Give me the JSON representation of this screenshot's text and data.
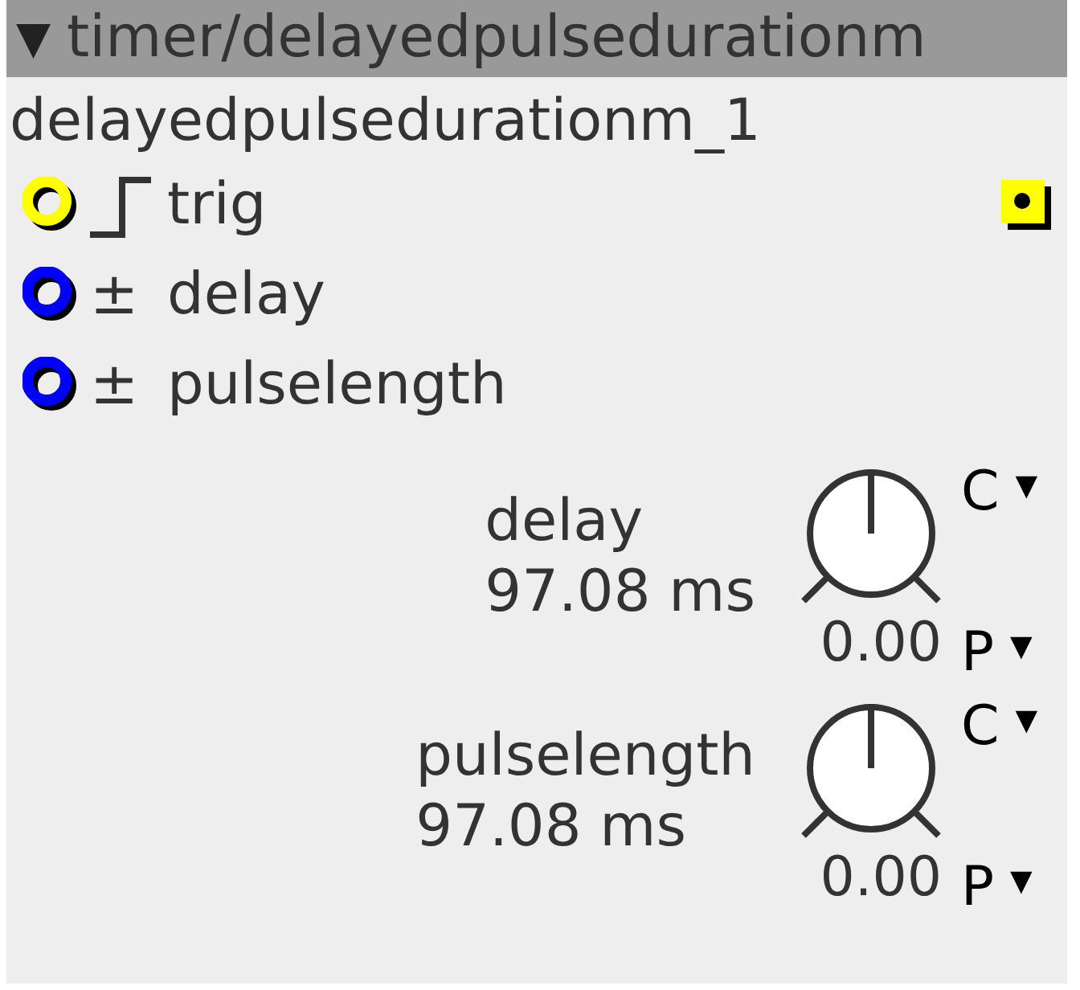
{
  "object": {
    "collapse": "▼",
    "type_name": "timer/delayedpulsedurationm",
    "instance_name": "delayedpulsedurationm_1"
  },
  "inlets": [
    {
      "kind": "bool",
      "label": "trig",
      "color": "#ffff00",
      "outlet": true
    },
    {
      "kind": "frac",
      "symbol": "±",
      "label": "delay",
      "color": "#0000ff",
      "outlet": false
    },
    {
      "kind": "frac",
      "symbol": "±",
      "label": "pulselength",
      "color": "#0000ff",
      "outlet": false
    }
  ],
  "params": [
    {
      "label": "delay",
      "value": "97.08 ms",
      "knob_value": "0.00",
      "c_menu": {
        "letter": "C",
        "caret": "▼"
      },
      "p_menu": {
        "letter": "P",
        "caret": "▼"
      }
    },
    {
      "label": "pulselength",
      "value": "97.08 ms",
      "knob_value": "0.00",
      "c_menu": {
        "letter": "C",
        "caret": "▼"
      },
      "p_menu": {
        "letter": "P",
        "caret": "▼"
      }
    }
  ]
}
